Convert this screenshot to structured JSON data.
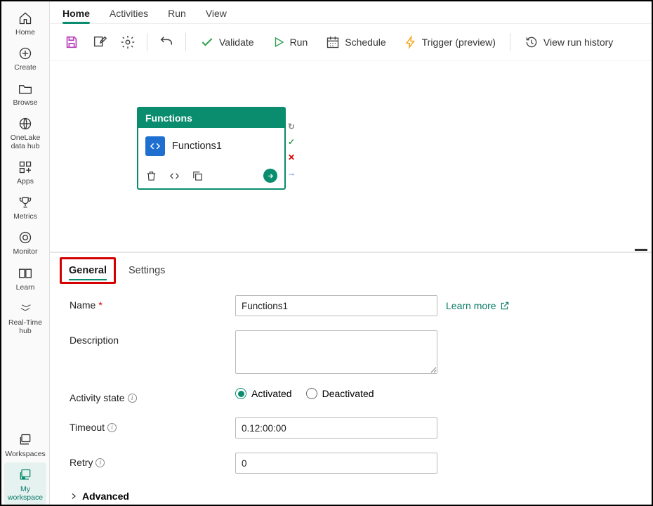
{
  "sidebar": {
    "items": [
      {
        "label": "Home",
        "icon": "home"
      },
      {
        "label": "Create",
        "icon": "plus-circle"
      },
      {
        "label": "Browse",
        "icon": "folder"
      },
      {
        "label": "OneLake data hub",
        "icon": "globe"
      },
      {
        "label": "Apps",
        "icon": "apps"
      },
      {
        "label": "Metrics",
        "icon": "trophy"
      },
      {
        "label": "Monitor",
        "icon": "target"
      },
      {
        "label": "Learn",
        "icon": "book"
      },
      {
        "label": "Real-Time hub",
        "icon": "stream"
      },
      {
        "label": "Workspaces",
        "icon": "workspaces"
      },
      {
        "label": "My workspace",
        "icon": "my-workspace",
        "active": true
      }
    ]
  },
  "top_tabs": [
    {
      "label": "Home",
      "active": true
    },
    {
      "label": "Activities"
    },
    {
      "label": "Run"
    },
    {
      "label": "View"
    }
  ],
  "toolbar": {
    "validate": "Validate",
    "run": "Run",
    "schedule": "Schedule",
    "trigger": "Trigger (preview)",
    "history": "View run history"
  },
  "canvas_node": {
    "header": "Functions",
    "title": "Functions1"
  },
  "props_tabs": [
    {
      "label": "General",
      "active": true,
      "highlight": true
    },
    {
      "label": "Settings"
    }
  ],
  "form": {
    "name_label": "Name",
    "name_value": "Functions1",
    "desc_label": "Description",
    "desc_value": "",
    "learn_more": "Learn more",
    "activity_label": "Activity state",
    "activity_opts": {
      "activated": "Activated",
      "deactivated": "Deactivated"
    },
    "timeout_label": "Timeout",
    "timeout_value": "0.12:00:00",
    "retry_label": "Retry",
    "retry_value": "0",
    "advanced": "Advanced"
  }
}
